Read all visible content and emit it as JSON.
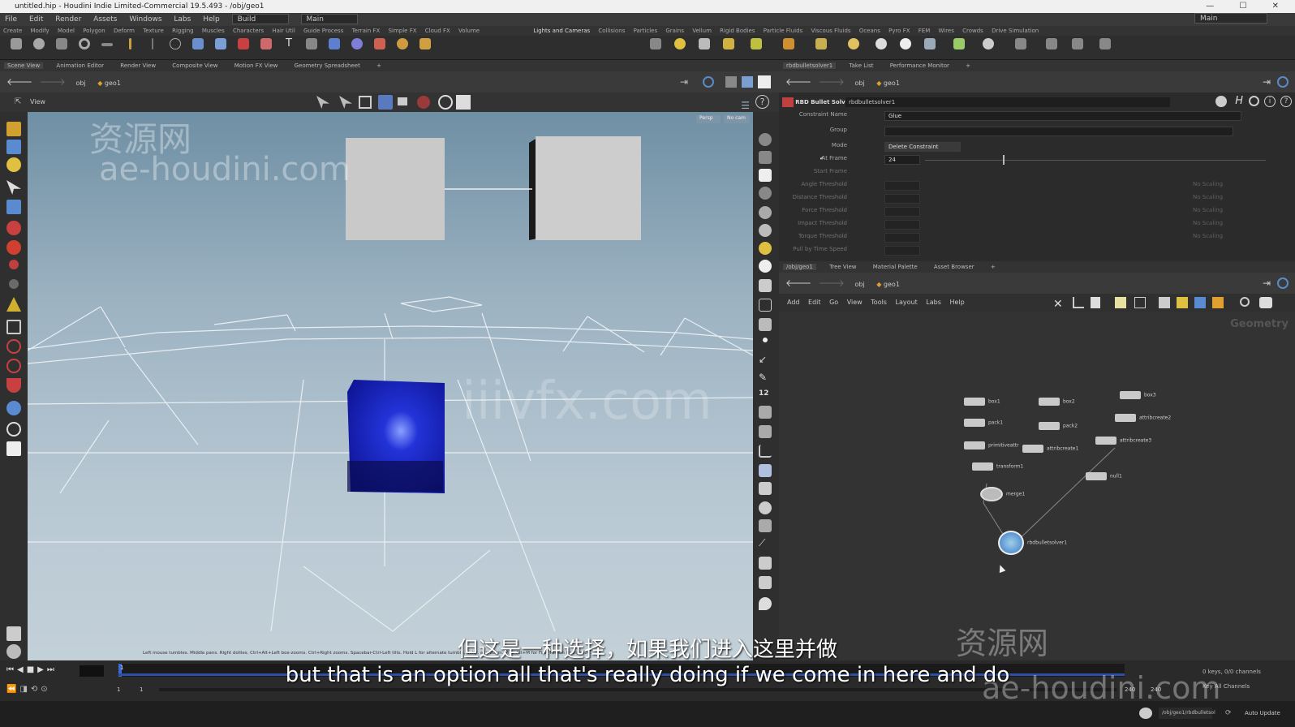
{
  "window": {
    "title": "untitled.hip - Houdini Indie Limited-Commercial 19.5.493 - /obj/geo1"
  },
  "menubar": {
    "items": [
      "File",
      "Edit",
      "Render",
      "Assets",
      "Windows",
      "Labs",
      "Help"
    ],
    "desktop": "Build",
    "main_selector": "Main",
    "right_selector": "Main"
  },
  "shelf_tabs_left": [
    "Create",
    "Modify",
    "Model",
    "Polygon",
    "Deform",
    "Texture",
    "Rigging",
    "Muscles",
    "Characters",
    "Hair Util",
    "Guide Process",
    "Terrain FX",
    "Simple FX",
    "Cloud FX",
    "Volume"
  ],
  "shelf_tabs_right": [
    "Lights and Cameras",
    "Collisions",
    "Particles",
    "Grains",
    "Vellum",
    "Rigid Bodies",
    "Particle Fluids",
    "Viscous Fluids",
    "Oceans",
    "Pyro FX",
    "FEM",
    "Wires",
    "Crowds",
    "Drive Simulation"
  ],
  "left_pane": {
    "tabs": [
      "Scene View",
      "Animation Editor",
      "Render View",
      "Composite View",
      "Motion FX View",
      "Geometry Spreadsheet"
    ],
    "path_obj": "obj",
    "path_geo": "geo1",
    "view_label": "View",
    "persp": "Persp",
    "cam": "No cam",
    "status_hint": "Left mouse tumbles. Middle pans. Right dollies. Ctrl+Alt+Left box-zooms. Ctrl+Right zooms. Spacebar-Ctrl-Left tilts. Hold L for alternate tumble, dolly, and zoom. M or Alt+M for First Person Navigation."
  },
  "param_pane": {
    "tabs": [
      "rbdbulletsolver1",
      "Take List",
      "Performance Monitor"
    ],
    "path_obj": "obj",
    "path_geo": "geo1",
    "node_type": "RBD Bullet Solver",
    "node_name": "rbdbulletsolver1",
    "params": [
      {
        "label": "Constraint Name",
        "value": "Glue"
      },
      {
        "label": "Group",
        "value": ""
      },
      {
        "label": "Mode",
        "value": "Delete Constraint"
      },
      {
        "label": "At Frame",
        "value": "24"
      },
      {
        "label": "Start Frame",
        "value": ""
      },
      {
        "label": "Angle Threshold",
        "value": ""
      },
      {
        "label": "Distance Threshold",
        "value": ""
      },
      {
        "label": "Force Threshold",
        "value": ""
      },
      {
        "label": "Impact Threshold",
        "value": ""
      },
      {
        "label": "Torque Threshold",
        "value": ""
      },
      {
        "label": "Pull by Time Speed",
        "value": ""
      }
    ],
    "no_scaling": "No Scaling"
  },
  "network_pane": {
    "tabs": [
      "/obj/geo1",
      "Tree View",
      "Material Palette",
      "Asset Browser"
    ],
    "path_obj": "obj",
    "path_geo": "geo1",
    "menu": [
      "Add",
      "Edit",
      "Go",
      "View",
      "Tools",
      "Layout",
      "Labs",
      "Help"
    ],
    "context_label": "Geometry",
    "nodes": [
      {
        "name": "box1"
      },
      {
        "name": "box2"
      },
      {
        "name": "box3"
      },
      {
        "name": "pack1"
      },
      {
        "name": "pack2"
      },
      {
        "name": "primitiveattr"
      },
      {
        "name": "attribcreate1"
      },
      {
        "name": "attribcreate2"
      },
      {
        "name": "transform1"
      },
      {
        "name": "attribcreate3"
      },
      {
        "name": "null1"
      },
      {
        "name": "merge1"
      },
      {
        "name": "rbdbulletsolver1"
      }
    ]
  },
  "timeline": {
    "frame": "1",
    "start": "1",
    "end": "1",
    "range_end_a": "240",
    "range_end_b": "240",
    "keys_label": "0 keys, 0/0 channels",
    "key_all": "Key All Channels"
  },
  "statusbar": {
    "path": "/obj/geo1/rbdbulletsol",
    "update": "Auto Update"
  },
  "overlay": {
    "subtitle_cn": "但这是一种选择，如果我们进入这里并做",
    "subtitle_en": "but that is an option all that's really doing if we come in here and do",
    "watermark_top_cn": "资源网",
    "watermark_top_url": "ae-houdini.com",
    "watermark_mid": "iiivfx.com",
    "watermark_bottom_cn": "资源网",
    "watermark_bottom_url": "ae-houdini.com"
  },
  "colors": {
    "accent_blue": "#1f2fc8",
    "ui_bg": "#2b2b2b",
    "viewport_top": "#6f8fa4",
    "viewport_bottom": "#c3d0d8"
  }
}
